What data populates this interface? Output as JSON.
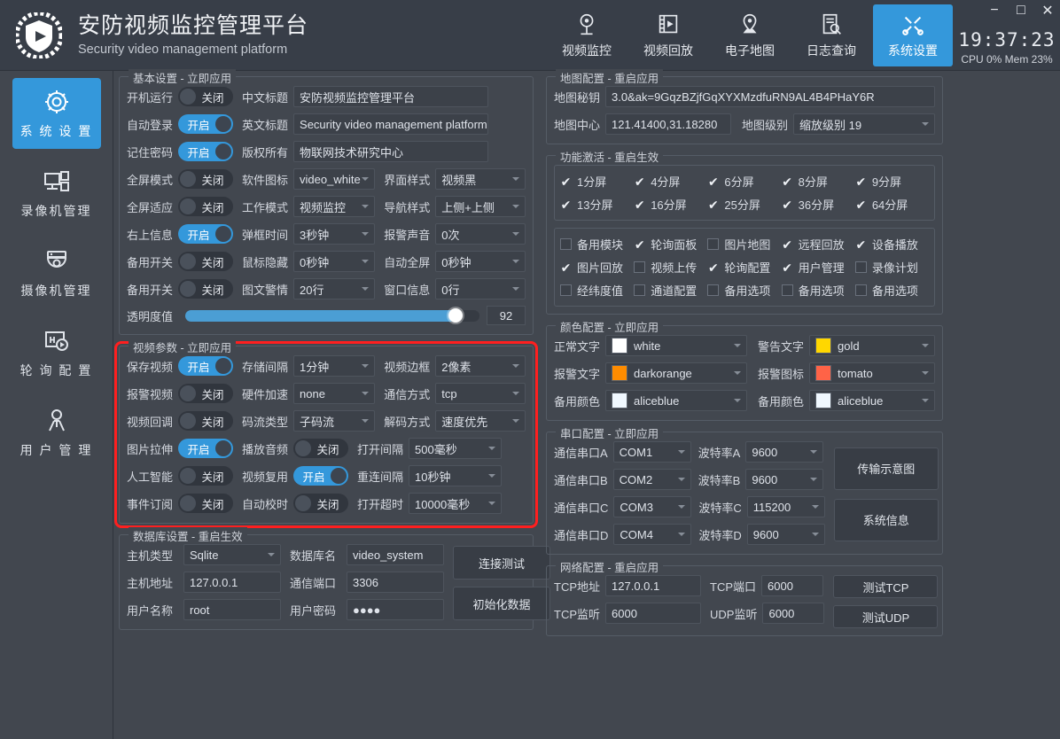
{
  "header": {
    "title_cn": "安防视频监控管理平台",
    "title_en": "Security video management platform",
    "logo_icon": "video-shield-play-icon",
    "nav": [
      {
        "label": "视频监控",
        "icon": "camera-icon",
        "active": false
      },
      {
        "label": "视频回放",
        "icon": "film-play-icon",
        "active": false
      },
      {
        "label": "电子地图",
        "icon": "map-pin-icon",
        "active": false
      },
      {
        "label": "日志查询",
        "icon": "document-search-icon",
        "active": false
      },
      {
        "label": "系统设置",
        "icon": "tools-icon",
        "active": true
      }
    ],
    "clock": "19:37:23",
    "sysinfo": "CPU 0%   Mem 23%",
    "window_controls": {
      "minimize": "−",
      "maximize": "□",
      "close": "✕"
    }
  },
  "sidebar": {
    "items": [
      {
        "label": "系 统 设 置",
        "icon": "gear-icon",
        "active": true
      },
      {
        "label": "录像机管理",
        "icon": "nvr-icon",
        "active": false
      },
      {
        "label": "摄像机管理",
        "icon": "dome-camera-icon",
        "active": false
      },
      {
        "label": "轮 询 配 置",
        "icon": "h-play-icon",
        "active": false
      },
      {
        "label": "用 户 管 理",
        "icon": "user-icon",
        "active": false
      }
    ]
  },
  "basic_settings": {
    "title": "基本设置 - 立即应用",
    "toggles": [
      {
        "label": "开机运行",
        "state": "关闭",
        "on": false
      },
      {
        "label": "自动登录",
        "state": "开启",
        "on": true
      },
      {
        "label": "记住密码",
        "state": "开启",
        "on": true
      },
      {
        "label": "全屏模式",
        "state": "关闭",
        "on": false
      },
      {
        "label": "全屏适应",
        "state": "关闭",
        "on": false
      },
      {
        "label": "右上信息",
        "state": "开启",
        "on": true
      },
      {
        "label": "备用开关",
        "state": "关闭",
        "on": false
      },
      {
        "label": "备用开关",
        "state": "关闭",
        "on": false
      }
    ],
    "fields": {
      "cn_title_label": "中文标题",
      "cn_title_value": "安防视频监控管理平台",
      "en_title_label": "英文标题",
      "en_title_value": "Security video management platform",
      "copyright_label": "版权所有",
      "copyright_value": "物联网技术研究中心",
      "soft_icon_label": "软件图标",
      "soft_icon_value": "video_white",
      "ui_style_label": "界面样式",
      "ui_style_value": "视频黑",
      "work_mode_label": "工作模式",
      "work_mode_value": "视频监控",
      "nav_style_label": "导航样式",
      "nav_style_value": "上侧+上侧",
      "popup_time_label": "弹框时间",
      "popup_time_value": "3秒钟",
      "alarm_sound_label": "报警声音",
      "alarm_sound_value": "0次",
      "mouse_hide_label": "鼠标隐藏",
      "mouse_hide_value": "0秒钟",
      "auto_full_label": "自动全屏",
      "auto_full_value": "0秒钟",
      "text_alarm_label": "图文警情",
      "text_alarm_value": "20行",
      "win_info_label": "窗口信息",
      "win_info_value": "0行"
    },
    "opacity": {
      "label": "透明度值",
      "value": 92,
      "percent": 92
    }
  },
  "video_params": {
    "title": "视频参数 - 立即应用",
    "rows": [
      {
        "t1_label": "保存视频",
        "t1_state": "开启",
        "t1_on": true,
        "c2_label": "存储间隔",
        "c2_value": "1分钟",
        "c2_type": "select",
        "c3_label": "视频边框",
        "c3_value": "2像素"
      },
      {
        "t1_label": "报警视频",
        "t1_state": "关闭",
        "t1_on": false,
        "c2_label": "硬件加速",
        "c2_value": "none",
        "c2_type": "select",
        "c3_label": "通信方式",
        "c3_value": "tcp"
      },
      {
        "t1_label": "视频回调",
        "t1_state": "关闭",
        "t1_on": false,
        "c2_label": "码流类型",
        "c2_value": "子码流",
        "c2_type": "select",
        "c3_label": "解码方式",
        "c3_value": "速度优先"
      },
      {
        "t1_label": "图片拉伸",
        "t1_state": "开启",
        "t1_on": true,
        "c2_label": "播放音频",
        "c2_value": "关闭",
        "c2_type": "toggle",
        "c2_on": false,
        "c3_label": "打开间隔",
        "c3_value": "500毫秒"
      },
      {
        "t1_label": "人工智能",
        "t1_state": "关闭",
        "t1_on": false,
        "c2_label": "视频复用",
        "c2_value": "开启",
        "c2_type": "toggle",
        "c2_on": true,
        "c3_label": "重连间隔",
        "c3_value": "10秒钟"
      },
      {
        "t1_label": "事件订阅",
        "t1_state": "关闭",
        "t1_on": false,
        "c2_label": "自动校时",
        "c2_value": "关闭",
        "c2_type": "toggle",
        "c2_on": false,
        "c3_label": "打开超时",
        "c3_value": "10000毫秒"
      }
    ]
  },
  "database_settings": {
    "title": "数据库设置 - 重启生效",
    "host_type_label": "主机类型",
    "host_type_value": "Sqlite",
    "db_name_label": "数据库名",
    "db_name_value": "video_system",
    "host_addr_label": "主机地址",
    "host_addr_value": "127.0.0.1",
    "comm_port_label": "通信端口",
    "comm_port_value": "3306",
    "user_name_label": "用户名称",
    "user_name_value": "root",
    "user_pwd_label": "用户密码",
    "user_pwd_value": "●●●●",
    "btn_test": "连接测试",
    "btn_init": "初始化数据"
  },
  "map_config": {
    "title": "地图配置 - 重启应用",
    "key_label": "地图秘钥",
    "key_value": "3.0&ak=9GqzBZjfGqXYXMzdfuRN9AL4B4PHaY6R",
    "center_label": "地图中心",
    "center_value": "121.41400,31.18280",
    "level_label": "地图级别",
    "level_value": "缩放级别 19"
  },
  "function_activation": {
    "title": "功能激活 - 重启生效",
    "split_rows": [
      [
        {
          "label": "1分屏",
          "checked": true
        },
        {
          "label": "4分屏",
          "checked": true
        },
        {
          "label": "6分屏",
          "checked": true
        },
        {
          "label": "8分屏",
          "checked": true
        },
        {
          "label": "9分屏",
          "checked": true
        }
      ],
      [
        {
          "label": "13分屏",
          "checked": true
        },
        {
          "label": "16分屏",
          "checked": true
        },
        {
          "label": "25分屏",
          "checked": true
        },
        {
          "label": "36分屏",
          "checked": true
        },
        {
          "label": "64分屏",
          "checked": true
        }
      ]
    ],
    "module_rows": [
      [
        {
          "label": "备用模块",
          "checked": false
        },
        {
          "label": "轮询面板",
          "checked": true
        },
        {
          "label": "图片地图",
          "checked": false
        },
        {
          "label": "远程回放",
          "checked": true
        },
        {
          "label": "设备播放",
          "checked": true
        }
      ],
      [
        {
          "label": "图片回放",
          "checked": true
        },
        {
          "label": "视频上传",
          "checked": false
        },
        {
          "label": "轮询配置",
          "checked": true
        },
        {
          "label": "用户管理",
          "checked": true
        },
        {
          "label": "录像计划",
          "checked": false
        }
      ],
      [
        {
          "label": "经纬度值",
          "checked": false
        },
        {
          "label": "通道配置",
          "checked": false
        },
        {
          "label": "备用选项",
          "checked": false
        },
        {
          "label": "备用选项",
          "checked": false
        },
        {
          "label": "备用选项",
          "checked": false
        }
      ]
    ]
  },
  "color_config": {
    "title": "颜色配置 - 立即应用",
    "items": [
      {
        "label": "正常文字",
        "value": "white",
        "hex": "#ffffff"
      },
      {
        "label": "警告文字",
        "value": "gold",
        "hex": "#ffd700"
      },
      {
        "label": "报警文字",
        "value": "darkorange",
        "hex": "#ff8c00"
      },
      {
        "label": "报警图标",
        "value": "tomato",
        "hex": "#ff6347"
      },
      {
        "label": "备用颜色",
        "value": "aliceblue",
        "hex": "#f0f8ff"
      },
      {
        "label": "备用颜色",
        "value": "aliceblue",
        "hex": "#f0f8ff"
      }
    ]
  },
  "serial_config": {
    "title": "串口配置 - 立即应用",
    "rows": [
      {
        "port_label": "通信串口A",
        "port_value": "COM1",
        "baud_label": "波特率A",
        "baud_value": "9600"
      },
      {
        "port_label": "通信串口B",
        "port_value": "COM2",
        "baud_label": "波特率B",
        "baud_value": "9600"
      },
      {
        "port_label": "通信串口C",
        "port_value": "COM3",
        "baud_label": "波特率C",
        "baud_value": "115200"
      },
      {
        "port_label": "通信串口D",
        "port_value": "COM4",
        "baud_label": "波特率D",
        "baud_value": "9600"
      }
    ],
    "btn_diagram": "传输示意图",
    "btn_sysinfo": "系统信息"
  },
  "network_config": {
    "title": "网络配置 - 重启应用",
    "tcp_addr_label": "TCP地址",
    "tcp_addr_value": "127.0.0.1",
    "tcp_port_label": "TCP端口",
    "tcp_port_value": "6000",
    "tcp_listen_label": "TCP监听",
    "tcp_listen_value": "6000",
    "udp_listen_label": "UDP监听",
    "udp_listen_value": "6000",
    "btn_test_tcp": "测试TCP",
    "btn_test_udp": "测试UDP"
  }
}
